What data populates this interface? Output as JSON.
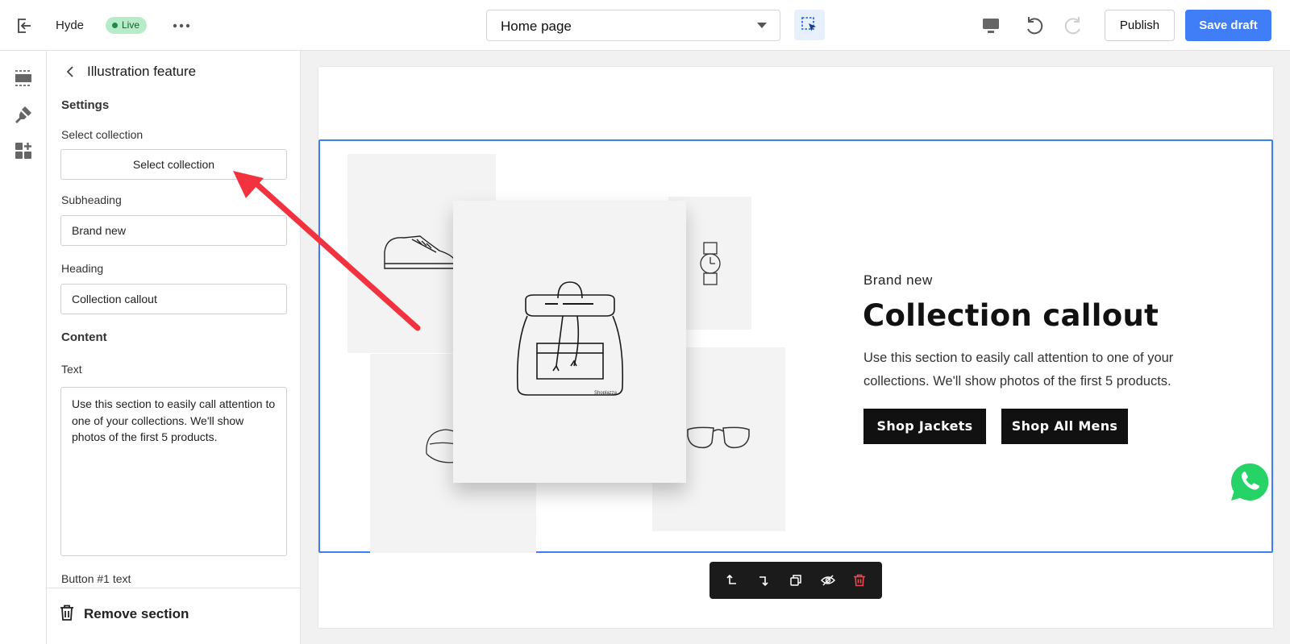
{
  "topbar": {
    "store_name": "Hyde",
    "live_badge": "Live",
    "page_select_value": "Home page",
    "publish_label": "Publish",
    "save_label": "Save draft",
    "icons": [
      "exit-icon",
      "more-icon",
      "inspect-icon",
      "desktop-icon",
      "undo-icon",
      "redo-icon"
    ]
  },
  "rail": {
    "icons": [
      "sections-icon",
      "theme-style-icon",
      "apps-icon"
    ]
  },
  "panel": {
    "title": "Illustration feature",
    "settings_heading": "Settings",
    "select_collection_label": "Select collection",
    "select_collection_button": "Select collection",
    "subheading_label": "Subheading",
    "subheading_value": "Brand new",
    "heading_label": "Heading",
    "heading_value": "Collection callout",
    "content_heading": "Content",
    "text_label": "Text",
    "text_value": "Use this section to easily call attention to one of your collections. We'll show photos of the first 5 products.",
    "button1_label": "Button #1 text",
    "remove_label": "Remove section"
  },
  "preview": {
    "subheading": "Brand new",
    "heading": "Collection callout",
    "body": "Use this section to easily call attention to one of your collections. We'll show photos of the first 5 products.",
    "button1": "Shop Jackets",
    "button2": "Shop All Mens",
    "product_tiles": [
      "sneaker",
      "watch",
      "backpack",
      "cap",
      "glasses"
    ],
    "backpack_brand": "Shoplazza"
  },
  "section_toolbar": {
    "icons": [
      "move-up-icon",
      "move-down-icon",
      "duplicate-icon",
      "hide-icon",
      "delete-icon"
    ]
  },
  "colors": {
    "accent": "#3f7ef6",
    "live_badge_bg": "#b6ecc8",
    "annotation_arrow": "#f2323e",
    "whatsapp": "#25d366",
    "delete_red": "#f0464c"
  }
}
